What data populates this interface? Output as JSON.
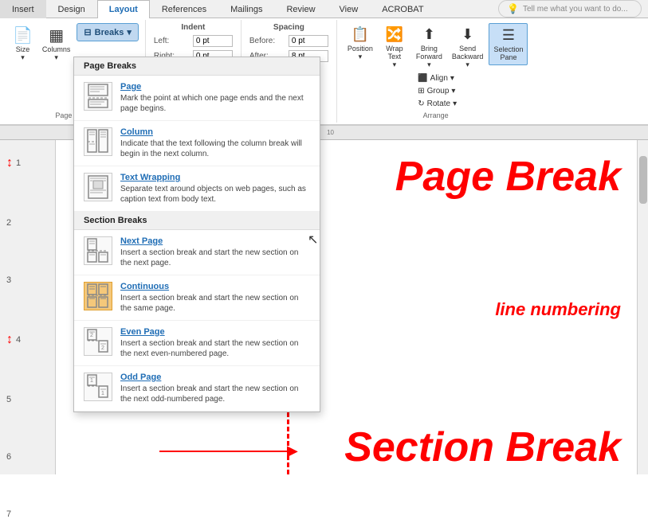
{
  "tabs": [
    {
      "label": "Insert",
      "active": false
    },
    {
      "label": "Design",
      "active": false
    },
    {
      "label": "Layout",
      "active": true
    },
    {
      "label": "References",
      "active": false
    },
    {
      "label": "Mailings",
      "active": false
    },
    {
      "label": "Review",
      "active": false
    },
    {
      "label": "View",
      "active": false
    },
    {
      "label": "ACROBAT",
      "active": false
    }
  ],
  "tell_me": "Tell me what you want to do...",
  "ribbon": {
    "page_setup_group": "Page Setup",
    "indent_group": "Indent",
    "spacing_group": "Spacing",
    "arrange_group": "Arrange",
    "breaks_label": "Breaks",
    "size_label": "Size",
    "columns_label": "Columns",
    "indent_left_label": "Left:",
    "indent_left_value": "0 pt",
    "indent_right_label": "Right:",
    "indent_right_value": "0 pt",
    "spacing_before_label": "Before:",
    "spacing_before_value": "0 pt",
    "spacing_after_label": "After:",
    "spacing_after_value": "8 pt",
    "position_label": "Position",
    "wrap_text_label": "Wrap\nText",
    "bring_forward_label": "Bring\nForward",
    "send_backward_label": "Send\nBackward",
    "selection_pane_label": "Selection\nPane",
    "align_label": "Align",
    "group_label": "Group",
    "rotate_label": "Rotate"
  },
  "dropdown": {
    "page_breaks_title": "Page Breaks",
    "section_breaks_title": "Section Breaks",
    "items": [
      {
        "id": "page",
        "title": "Page",
        "desc": "Mark the point at which one page ends and the next page begins.",
        "icon": "page",
        "section": "page"
      },
      {
        "id": "column",
        "title": "Column",
        "desc": "Indicate that the text following the column break will begin in the next column.",
        "icon": "column",
        "section": "page"
      },
      {
        "id": "text-wrapping",
        "title": "Text Wrapping",
        "desc": "Separate text around objects on web pages, such as caption text from body text.",
        "icon": "textwrap",
        "section": "page"
      },
      {
        "id": "next-page",
        "title": "Next Page",
        "desc": "Insert a section break and start the new section on the next page.",
        "icon": "nextpage",
        "section": "section"
      },
      {
        "id": "continuous",
        "title": "Continuous",
        "desc": "Insert a section break and start the new section on the same page.",
        "icon": "continuous",
        "section": "section",
        "highlight": true
      },
      {
        "id": "even-page",
        "title": "Even Page",
        "desc": "Insert a section break and start the new section on the next even-numbered page.",
        "icon": "evenpage",
        "section": "section"
      },
      {
        "id": "odd-page",
        "title": "Odd Page",
        "desc": "Insert a section break and start the new section on the next odd-numbered page.",
        "icon": "oddpage",
        "section": "section"
      }
    ]
  },
  "annotations": {
    "page_break": "Page\nBreak",
    "line_numbering": "line numbering",
    "section_break": "Section\nBreak"
  },
  "line_numbers": [
    "1",
    "2",
    "3",
    "4",
    "5",
    "6",
    "7"
  ]
}
